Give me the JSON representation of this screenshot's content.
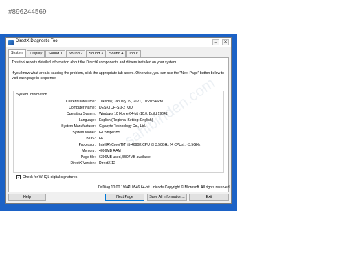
{
  "listing_id": "#896244569",
  "window": {
    "title": "DirectX Diagnostic Tool",
    "controls": {
      "minimize": "–",
      "maximize": "□",
      "close": "✕"
    }
  },
  "tabs": [
    "System",
    "Display",
    "Sound 1",
    "Sound 2",
    "Sound 3",
    "Sound 4",
    "Input"
  ],
  "active_tab": "System",
  "intro_line_1": "This tool reports detailed information about the DirectX components and drivers installed on your system.",
  "intro_line_2": "If you know what area is causing the problem, click the appropriate tab above.  Otherwise, you can use the \"Next Page\" button below to",
  "intro_line_3": "visit each page in sequence.",
  "system_info": {
    "title": "System Information",
    "rows": [
      {
        "label": "Current Date/Time:",
        "value": "Tuesday, January 19, 2021, 10:20:54 PM"
      },
      {
        "label": "Computer Name:",
        "value": "DESKTOP-S1F2TQD"
      },
      {
        "label": "Operating System:",
        "value": "Windows 10 Home 64-bit (10.0, Build 19041)"
      },
      {
        "label": "Language:",
        "value": "English (Regional Setting: English)"
      },
      {
        "label": "System Manufacturer:",
        "value": "Gigabyte Technology Co., Ltd."
      },
      {
        "label": "System Model:",
        "value": "G1.Sniper B5"
      },
      {
        "label": "BIOS:",
        "value": "F6"
      },
      {
        "label": "Processor:",
        "value": "Intel(R) Core(TM) i5-4690K CPU @ 3.50GHz (4 CPUs), ~3.5GHz"
      },
      {
        "label": "Memory:",
        "value": "4096MB RAM"
      },
      {
        "label": "Page file:",
        "value": "6396MB used, 5507MB available"
      },
      {
        "label": "DirectX Version:",
        "value": "DirectX 12"
      }
    ]
  },
  "whql_checkbox": {
    "label": "Check for WHQL digital signatures",
    "checked": true
  },
  "footer_text": "DxDiag 10.00.19041.0546 64-bit Unicode  Copyright © Microsoft. All rights reserved.",
  "buttons": {
    "help": "Help",
    "next_page": "Next Page",
    "save_all": "Save All Information...",
    "exit": "Exit"
  },
  "watermark": "sahibinden.com",
  "colors": {
    "desktop_blue": "#1c62c6",
    "window_bg": "#f0f0f0",
    "default_button_border": "#0078d7"
  }
}
